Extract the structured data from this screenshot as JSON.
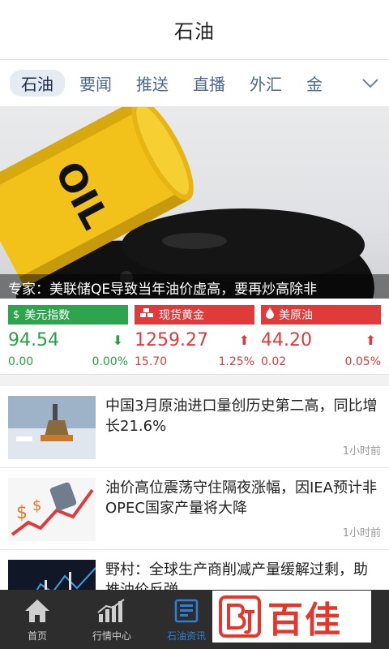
{
  "header": {
    "title": "石油"
  },
  "tabs": [
    {
      "label": "石油",
      "active": true
    },
    {
      "label": "要闻"
    },
    {
      "label": "推送"
    },
    {
      "label": "直播"
    },
    {
      "label": "外汇"
    },
    {
      "label": "金"
    }
  ],
  "banner": {
    "barrel_text": "OIL",
    "caption": "专家：美联储QE导致当年油价虚高，要再炒高除非"
  },
  "quotes": [
    {
      "name": "美元指数",
      "icon": "dollar-icon",
      "price": "94.54",
      "change": "0.00",
      "percent": "0.00%",
      "direction": "down",
      "color": "#2ea44f"
    },
    {
      "name": "现货黄金",
      "icon": "gold-bars-icon",
      "price": "1259.27",
      "change": "15.70",
      "percent": "1.25%",
      "direction": "up",
      "color": "#e03b3b"
    },
    {
      "name": "美原油",
      "icon": "oil-drop-icon",
      "price": "44.20",
      "change": "0.02",
      "percent": "0.05%",
      "direction": "up",
      "color": "#e03b3b"
    }
  ],
  "news": [
    {
      "title": "中国3月原油进口量创历史第二高，同比增长21.6%",
      "time": "1小时前"
    },
    {
      "title": "油价高位震荡守住隔夜涨幅，因IEA预计非OPEC国家产量将大降",
      "time": "1小时前"
    },
    {
      "title": "野村：全球生产商削减产量缓解过剩，助推油价反弹",
      "time": ""
    }
  ],
  "bottom_nav": [
    {
      "label": "首页",
      "icon": "home-icon"
    },
    {
      "label": "行情中心",
      "icon": "chart-icon"
    },
    {
      "label": "石油资讯",
      "icon": "news-icon",
      "active": true
    }
  ],
  "watermark": {
    "text": "百佳"
  }
}
